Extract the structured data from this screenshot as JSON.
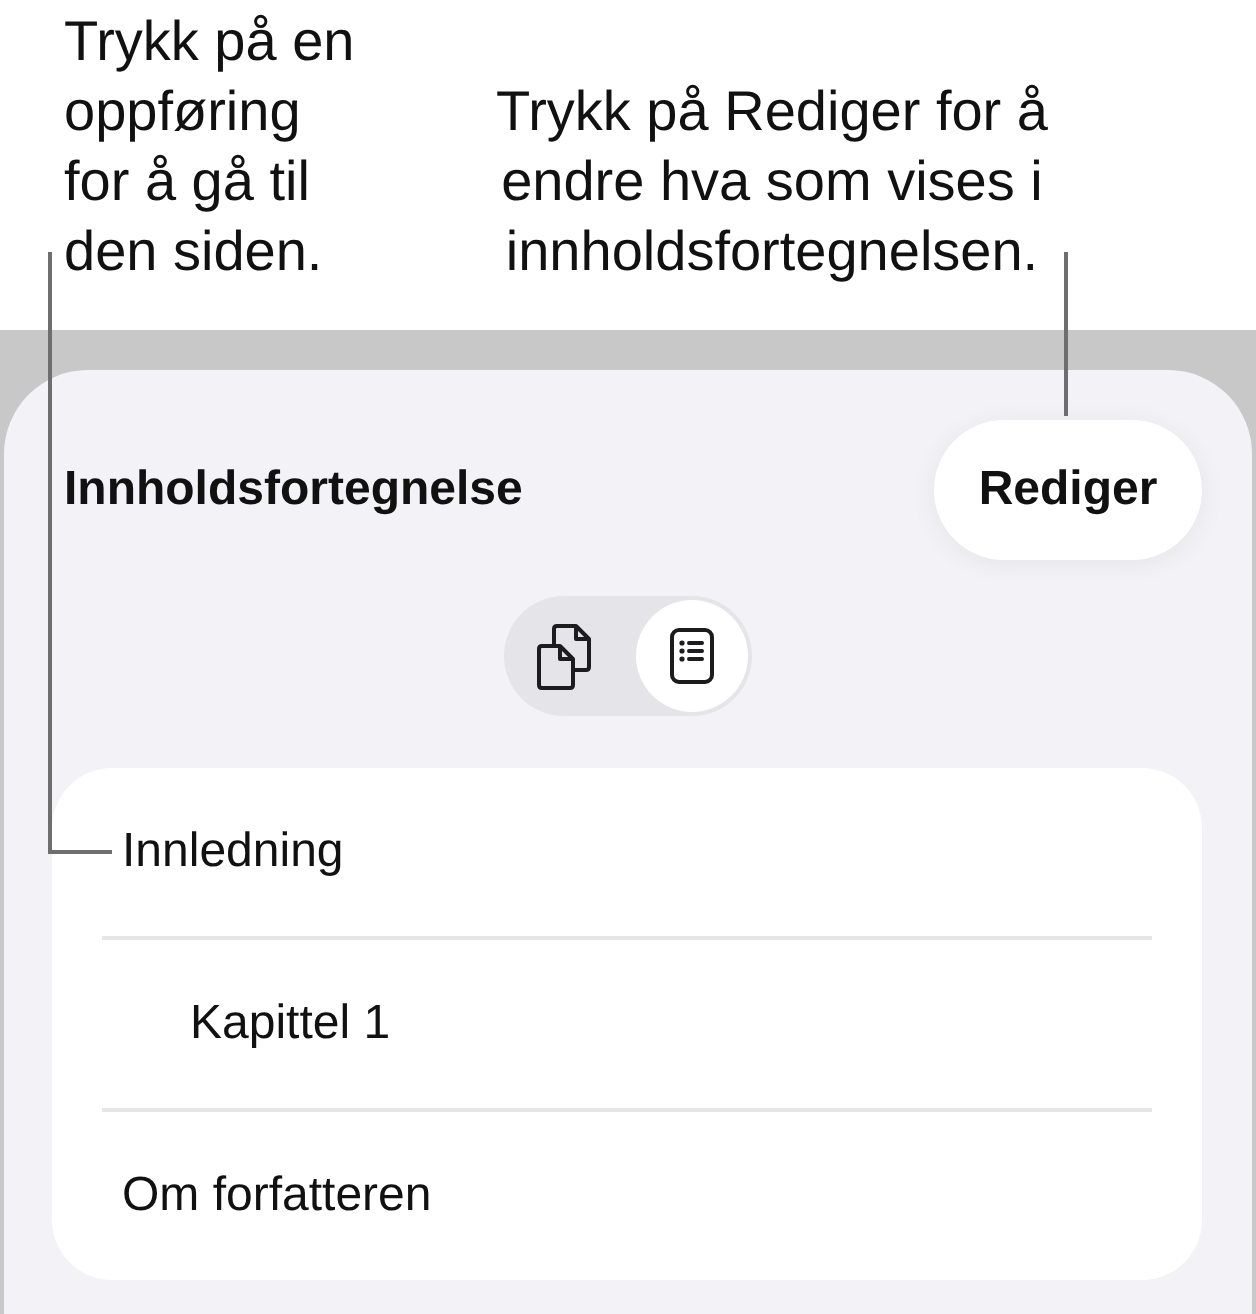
{
  "callouts": [
    {
      "text": "Trykk på en oppføring for å gå til den siden."
    },
    {
      "text": "Trykk på Rediger for å endre hva som vises i innholdsfortegnelsen."
    }
  ],
  "sheet": {
    "title": "Innholdsfortegnelse",
    "edit_button": "Rediger",
    "view_toggle": [
      {
        "kind": "pages",
        "selected": false
      },
      {
        "kind": "list",
        "selected": true
      }
    ],
    "entries": [
      {
        "label": "Innledning",
        "children": [
          {
            "label": "Kapittel 1"
          }
        ]
      },
      {
        "label": "Om forfatteren"
      }
    ]
  }
}
